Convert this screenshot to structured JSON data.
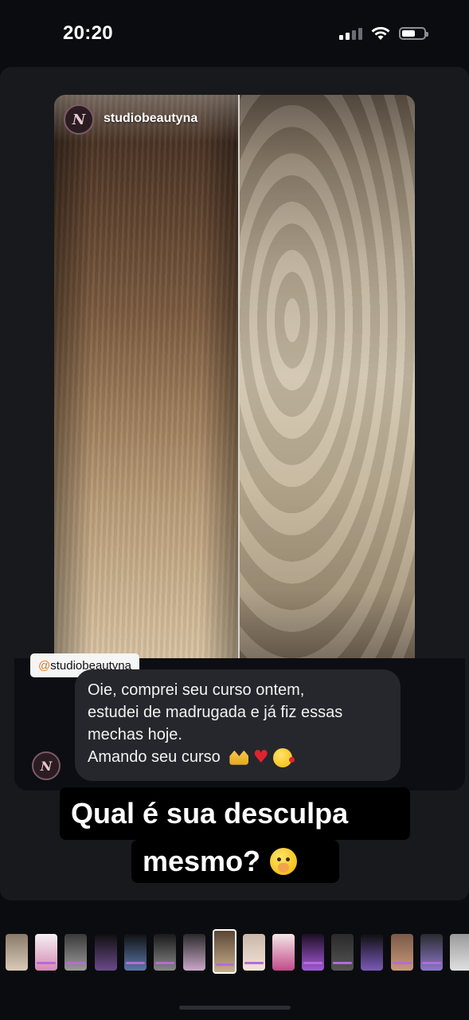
{
  "status_bar": {
    "time": "20:20",
    "icons": [
      "cellular-signal-icon",
      "wifi-icon",
      "battery-icon"
    ]
  },
  "story": {
    "username": "studiobeautyna",
    "avatar_monogram": "N",
    "photo_colors": {
      "left_hair_top": "#3d2a1f",
      "left_hair_tip": "#d8c3a2",
      "right_hair_mid": "#cfc3ab"
    }
  },
  "dm": {
    "mention_at": "@",
    "mention_handle": "studiobeautyna",
    "avatar_monogram": "N",
    "message_lines": [
      "Oie, comprei seu curso ontem,",
      "estudei de madrugada e já fiz essas",
      "mechas hoje.",
      "Amando seu curso"
    ],
    "message_emojis": [
      "heart-hands-emoji",
      "red-heart-emoji",
      "face-blowing-kiss-emoji"
    ]
  },
  "caption": {
    "line1": "Qual é sua desculpa",
    "line2": "mesmo?",
    "emoji": "face-with-hand-over-mouth-emoji"
  },
  "thumbnails": {
    "count": 17,
    "active_index": 7
  },
  "colors": {
    "background": "#0b0c10",
    "panel": "#18191c",
    "bubble": "#26272c",
    "caption_bg": "#000000",
    "mention_at": "#e07b1d"
  }
}
